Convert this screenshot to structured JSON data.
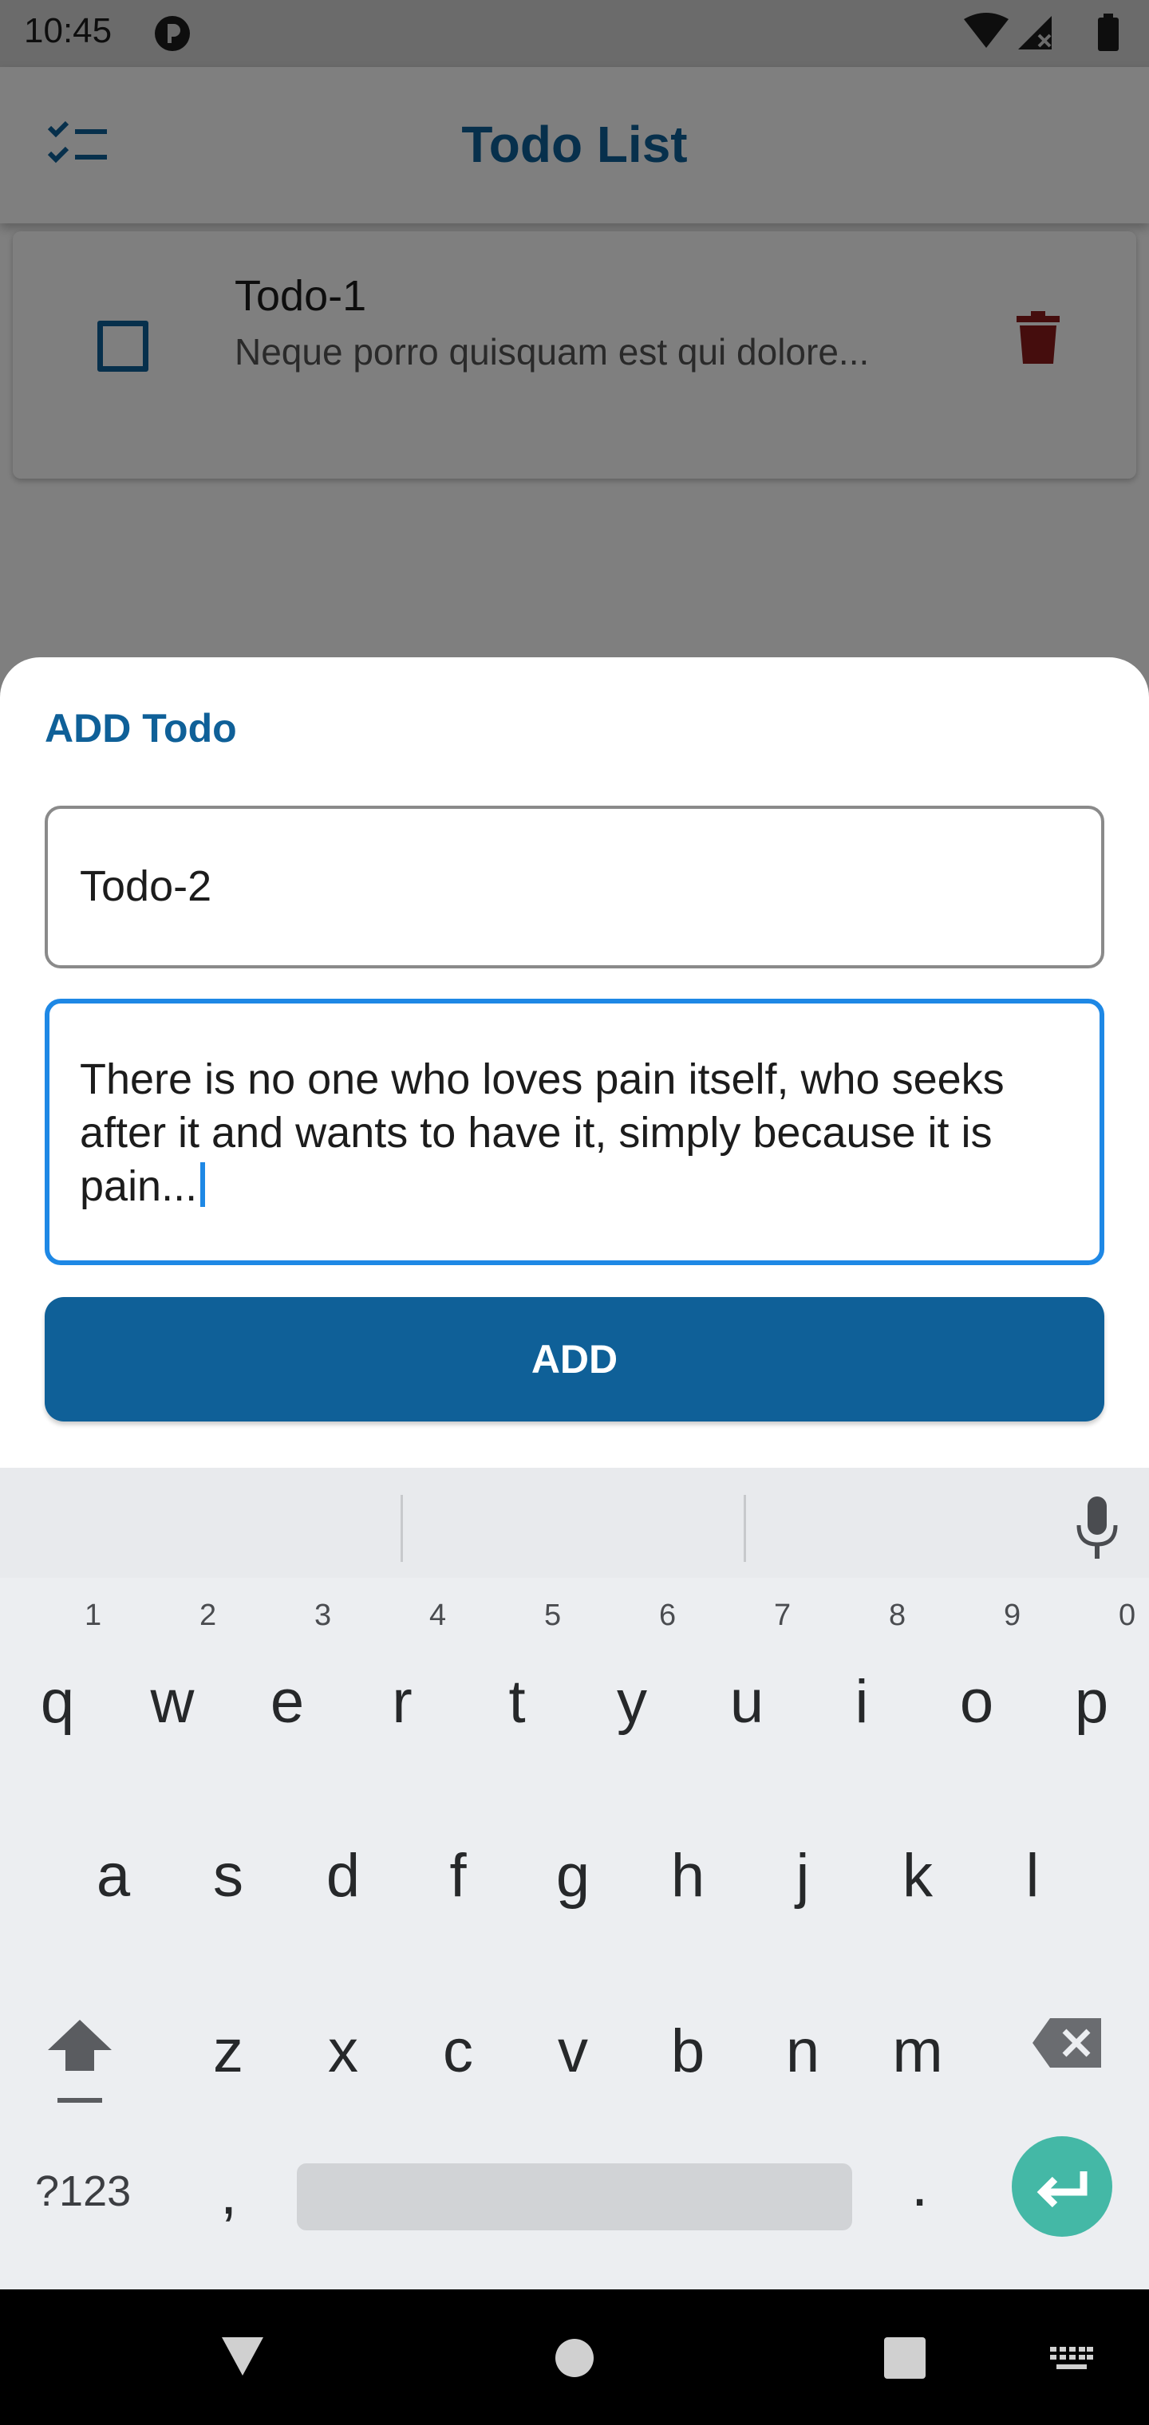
{
  "status_bar": {
    "time": "10:45"
  },
  "app_bar": {
    "title": "Todo List",
    "menu_icon": "checklist-icon"
  },
  "todo_list": [
    {
      "title": "Todo-1",
      "description": "Neque porro quisquam est qui dolore...",
      "checked": false
    }
  ],
  "add_sheet": {
    "heading": "ADD Todo",
    "title_value": "Todo-2",
    "description_value": "There is no one who loves pain itself, who seeks after it and wants to have it, simply because it is pain...",
    "add_label": "ADD"
  },
  "keyboard": {
    "row1": [
      "q",
      "w",
      "e",
      "r",
      "t",
      "y",
      "u",
      "i",
      "o",
      "p"
    ],
    "row1_hints": [
      "1",
      "2",
      "3",
      "4",
      "5",
      "6",
      "7",
      "8",
      "9",
      "0"
    ],
    "row2": [
      "a",
      "s",
      "d",
      "f",
      "g",
      "h",
      "j",
      "k",
      "l"
    ],
    "row3": [
      "z",
      "x",
      "c",
      "v",
      "b",
      "n",
      "m"
    ],
    "symbols_label": "?123",
    "comma": ",",
    "period": "."
  },
  "colors": {
    "primary": "#0f6098",
    "focus": "#1e88e5",
    "delete": "#8b1a1a",
    "enter": "#44b8a6"
  }
}
